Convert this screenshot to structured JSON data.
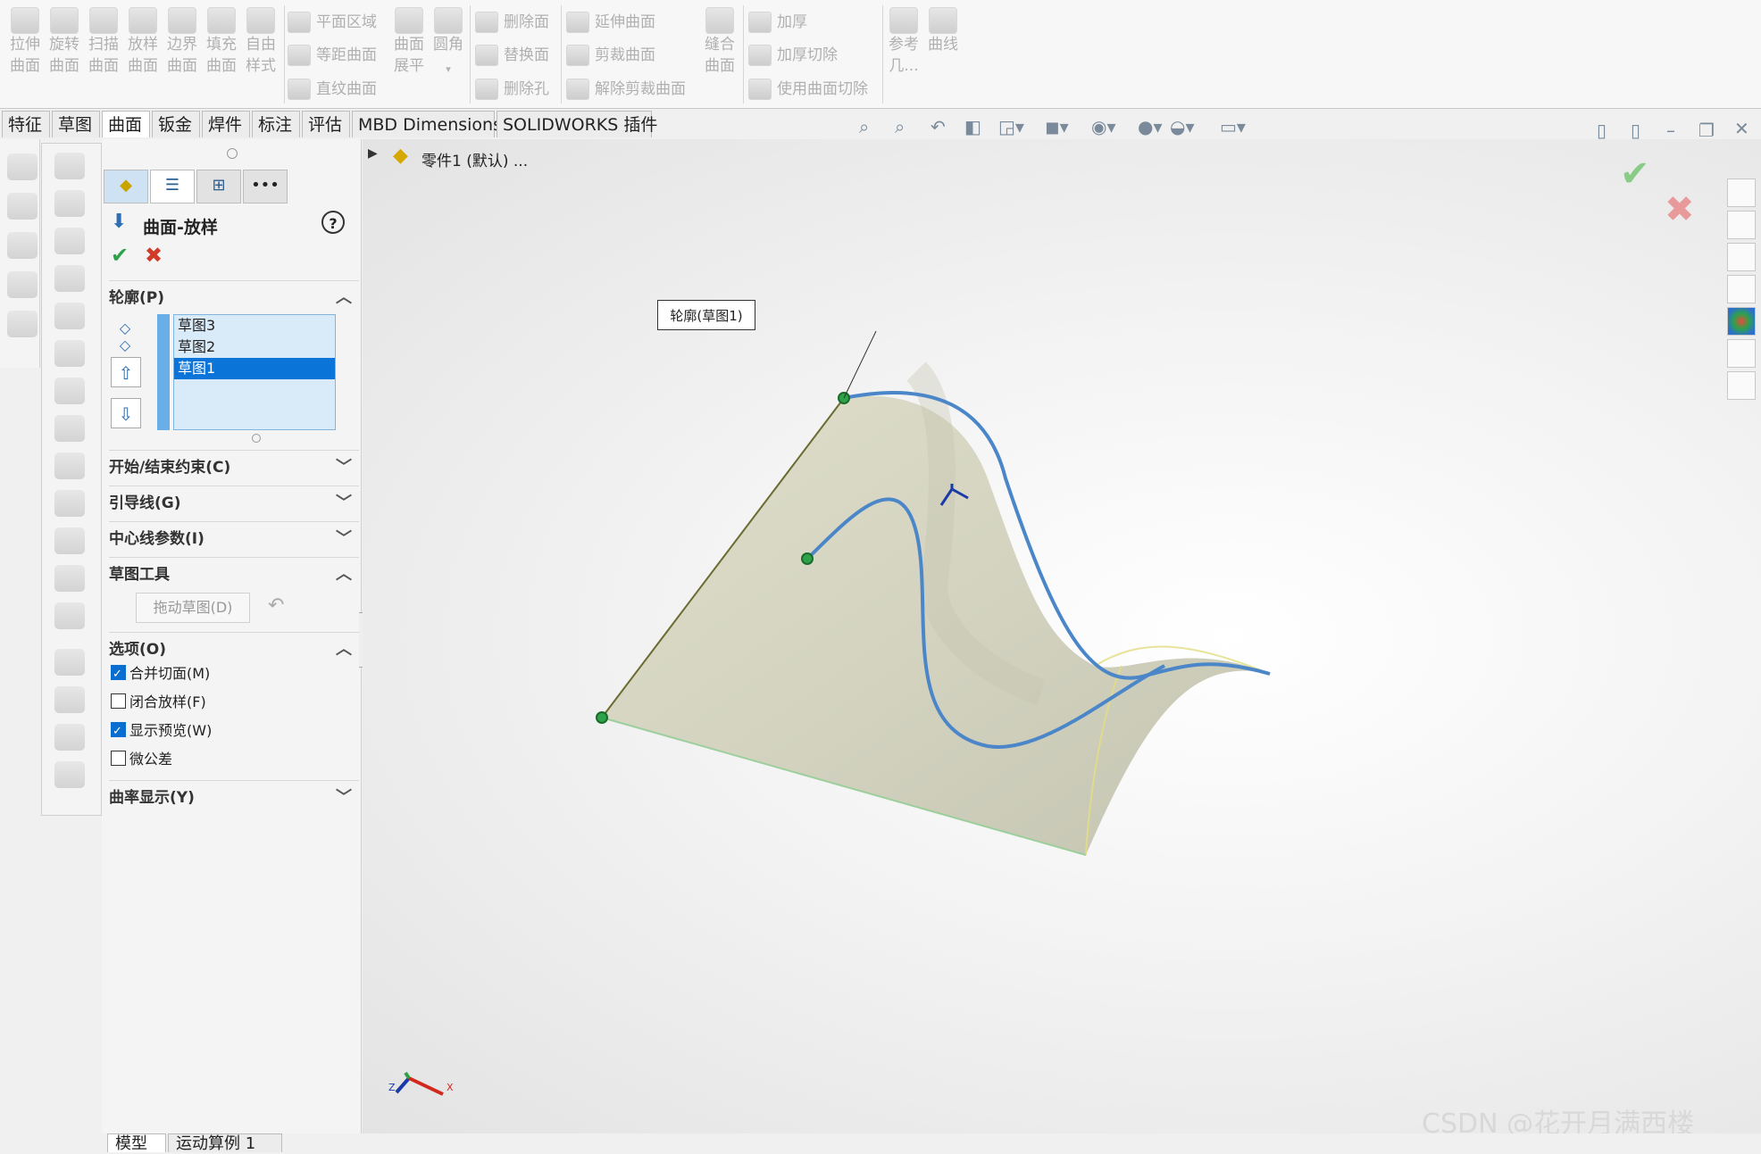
{
  "ribbon": {
    "big_buttons": [
      {
        "line1": "拉伸",
        "line2": "曲面",
        "icon": "extrude-surface-icon"
      },
      {
        "line1": "旋转",
        "line2": "曲面",
        "icon": "revolve-surface-icon"
      },
      {
        "line1": "扫描",
        "line2": "曲面",
        "icon": "sweep-surface-icon"
      },
      {
        "line1": "放样",
        "line2": "曲面",
        "icon": "loft-surface-icon"
      },
      {
        "line1": "边界",
        "line2": "曲面",
        "icon": "boundary-surface-icon"
      },
      {
        "line1": "填充",
        "line2": "曲面",
        "icon": "fill-surface-icon"
      },
      {
        "line1": "自由",
        "line2": "样式",
        "icon": "freeform-icon"
      }
    ],
    "group2": {
      "planar": "平面区域",
      "offset": "等距曲面",
      "ruled": "直纹曲面",
      "flatten1": "曲面",
      "flatten2": "展平",
      "fillet": "圆角"
    },
    "group3": {
      "delete_face": "删除面",
      "replace_face": "替换面",
      "delete_hole": "删除孔"
    },
    "group4": {
      "extend": "延伸曲面",
      "trim": "剪裁曲面",
      "untrim": "解除剪裁曲面",
      "knit1": "缝合",
      "knit2": "曲面"
    },
    "group5": {
      "thicken": "加厚",
      "thicken_cut": "加厚切除",
      "surface_cut": "使用曲面切除"
    },
    "group6": {
      "ref1": "参考",
      "ref2": "几...",
      "curves": "曲线"
    }
  },
  "tabs": [
    "特征",
    "草图",
    "曲面",
    "钣金",
    "焊件",
    "标注",
    "评估",
    "MBD Dimensions",
    "SOLIDWORKS 插件"
  ],
  "active_tab": "曲面",
  "tree": {
    "breadcrumb": "零件1 (默认) ..."
  },
  "pm": {
    "title": "曲面-放样",
    "help": "?",
    "more": "•••",
    "sections": {
      "profile": "轮廓(P)",
      "constraints": "开始/结束约束(C)",
      "guides": "引导线(G)",
      "centerline": "中心线参数(I)",
      "sketch_tools": "草图工具",
      "options": "选项(O)",
      "curvature": "曲率显示(Y)"
    },
    "profiles": [
      "草图3",
      "草图2",
      "草图1"
    ],
    "selected_profile": "草图1",
    "drag_sketch": "拖动草图(D)",
    "options": [
      {
        "label": "合并切面(M)",
        "checked": true
      },
      {
        "label": "闭合放样(F)",
        "checked": false
      },
      {
        "label": "显示预览(W)",
        "checked": true
      },
      {
        "label": "微公差",
        "checked": false
      }
    ]
  },
  "viewport": {
    "callout": "轮廓(草图1)",
    "triad": {
      "x": "X",
      "z": "Z"
    },
    "watermark": "CSDN @花开月满西楼"
  },
  "bottom_tabs": [
    "模型",
    "运动算例 1"
  ],
  "colors": {
    "accent": "#0a74d8",
    "curve": "#4a86c8",
    "surface": "#d7d7c4",
    "ok": "#2ea24a",
    "cancel": "#d23a2a"
  }
}
